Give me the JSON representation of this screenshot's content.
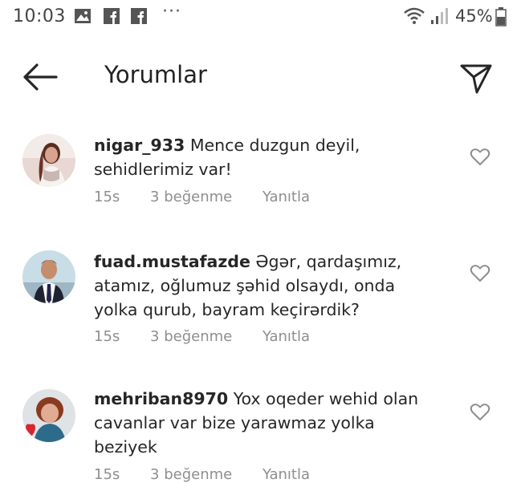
{
  "status_bar": {
    "time": "10:03",
    "battery": "45%",
    "icons": [
      "image-icon",
      "facebook-icon",
      "facebook-icon",
      "more-icon",
      "wifi-icon",
      "signal-icon",
      "battery-icon"
    ]
  },
  "header": {
    "title": "Yorumlar"
  },
  "comments": [
    {
      "username": "nigar_933",
      "line1": "Mence duzgun deyil,",
      "line2": "sehidlerimiz var!",
      "line3": "",
      "time": "15s",
      "likes": "3 beğenme",
      "reply": "Yanıtla"
    },
    {
      "username": "fuad.mustafazde",
      "line1": "Əgər, qardaşımız,",
      "line2": "atamız, oğlumuz şəhid olsaydı, onda",
      "line3": "yolka qurub, bayram keçirərdik?",
      "time": "15s",
      "likes": "3 beğenme",
      "reply": "Yanıtla"
    },
    {
      "username": "mehriban8970",
      "line1": "Yox oqeder wehid olan",
      "line2": "cavanlar var bize yarawmaz yolka",
      "line3": "beziyek",
      "time": "15s",
      "likes": "3 beğenme",
      "reply": "Yanıtla"
    }
  ],
  "colors": {
    "text": "#262626",
    "secondary": "#8e8e8e"
  }
}
